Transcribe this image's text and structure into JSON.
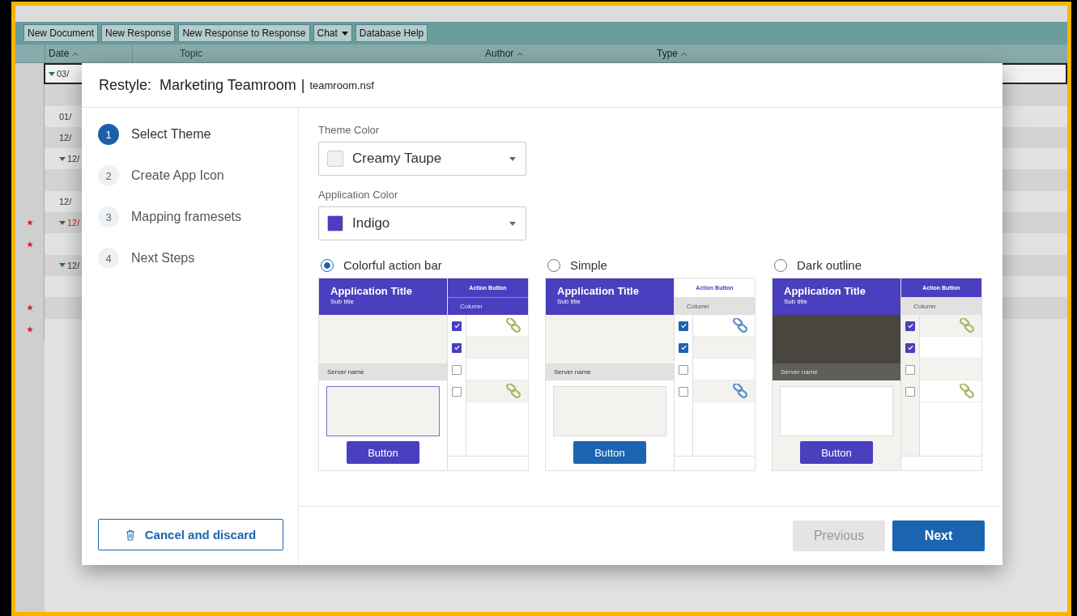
{
  "toolbar": {
    "buttons": [
      {
        "label": "New Document",
        "has_menu": false
      },
      {
        "label": "New Response",
        "has_menu": false
      },
      {
        "label": "New Response to Response",
        "has_menu": false
      },
      {
        "label": "Chat",
        "has_menu": true
      },
      {
        "label": "Database Help",
        "has_menu": false
      }
    ]
  },
  "view": {
    "columns": [
      {
        "label": "Date",
        "sorted": true
      },
      {
        "label": "Topic",
        "sorted": false
      },
      {
        "label": "Author",
        "sorted": true
      },
      {
        "label": "Type",
        "sorted": true
      }
    ],
    "rows": [
      {
        "date": "03/",
        "twisty": true,
        "starred": false,
        "unread": false,
        "selected": true
      },
      {
        "twisty": false,
        "starred": false,
        "selected": false
      },
      {
        "date": "01/",
        "twisty": false,
        "starred": false,
        "unread": false,
        "selected": false
      },
      {
        "date": "12/",
        "twisty": false,
        "starred": false,
        "unread": false,
        "selected": false
      },
      {
        "date": "12/",
        "twisty": true,
        "starred": false,
        "unread": false,
        "selected": false
      },
      {
        "twisty": false,
        "starred": false,
        "selected": false
      },
      {
        "date": "12/",
        "twisty": false,
        "starred": false,
        "unread": false,
        "selected": false
      },
      {
        "date": "12/",
        "twisty": true,
        "starred": true,
        "unread": true,
        "selected": false
      },
      {
        "twisty": false,
        "starred": true,
        "selected": false
      },
      {
        "date": "12/",
        "twisty": true,
        "starred": false,
        "unread": false,
        "selected": false
      },
      {
        "twisty": false,
        "starred": false,
        "selected": false
      },
      {
        "twisty": false,
        "starred": true,
        "selected": false
      },
      {
        "twisty": false,
        "starred": true,
        "selected": false
      }
    ]
  },
  "dialog": {
    "title": "Restyle:  Marketing Teamroom",
    "separator": "|",
    "file": "teamroom.nsf",
    "steps": [
      {
        "number": "1",
        "label": "Select Theme",
        "selected": true
      },
      {
        "number": "2",
        "label": "Create App Icon",
        "selected": false
      },
      {
        "number": "3",
        "label": "Mapping framesets",
        "selected": false
      },
      {
        "number": "4",
        "label": "Next Steps",
        "selected": false
      }
    ],
    "fields": [
      {
        "label": "Theme Color",
        "value": "Creamy Taupe",
        "color": "#f3f1ec"
      },
      {
        "label": "Application Color",
        "value": "Indigo",
        "color": "#4a3fbf"
      }
    ],
    "themes": [
      {
        "label": "Colorful action bar",
        "selected": true,
        "kind": "colorful",
        "app_title": "Application Title",
        "sub_title": "Sub title",
        "action": "Action Button",
        "column": "Column",
        "server": "Server name",
        "button": "Button",
        "rows": [
          {
            "checked": true,
            "link": true
          },
          {
            "checked": true,
            "link": false
          },
          {
            "checked": false,
            "link": false
          },
          {
            "checked": false,
            "link": true
          }
        ]
      },
      {
        "label": "Simple",
        "selected": false,
        "kind": "simple",
        "app_title": "Application Title",
        "sub_title": "Sub title",
        "action": "Action Button",
        "column": "Column",
        "server": "Server name",
        "button": "Button",
        "rows": [
          {
            "checked": true,
            "link": true
          },
          {
            "checked": true,
            "link": false
          },
          {
            "checked": false,
            "link": false
          },
          {
            "checked": false,
            "link": true
          }
        ]
      },
      {
        "label": "Dark outline",
        "selected": false,
        "kind": "dark",
        "app_title": "Application Title",
        "sub_title": "Sub title",
        "action": "Action Button",
        "column": "Column",
        "server": "Server name",
        "button": "Button",
        "rows": [
          {
            "checked": true,
            "link": true
          },
          {
            "checked": true,
            "link": false
          },
          {
            "checked": false,
            "link": false
          },
          {
            "checked": false,
            "link": true
          }
        ]
      }
    ],
    "cancel": "Cancel and discard",
    "previous": {
      "label": "Previous",
      "disabled": true
    },
    "next": {
      "label": "Next",
      "disabled": false
    }
  }
}
